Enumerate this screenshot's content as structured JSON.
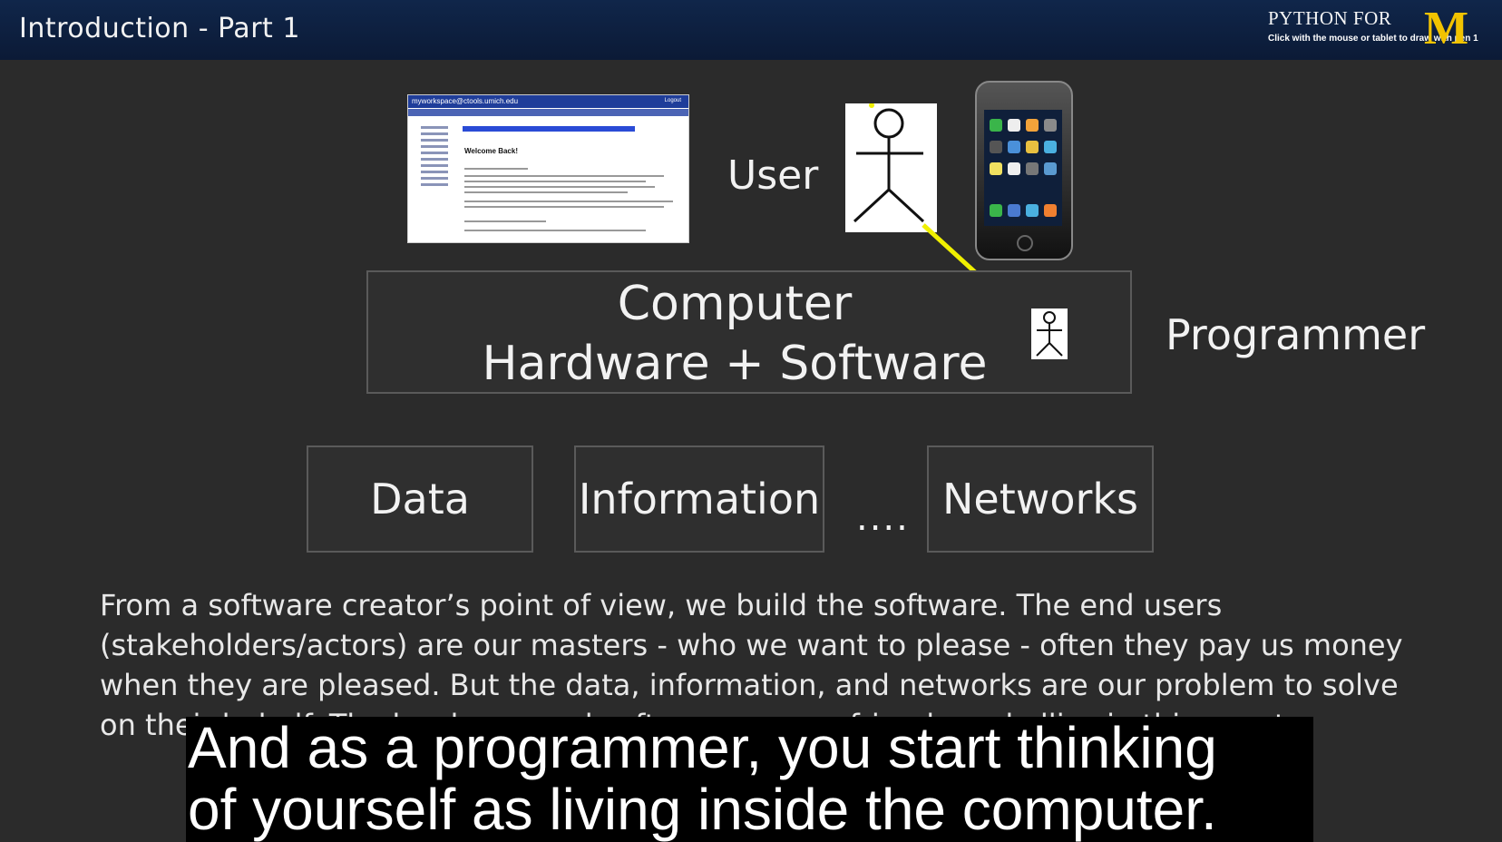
{
  "header": {
    "title": "Introduction - Part 1",
    "brand_line1": "PYTHON FOR",
    "brand_hint": "Click with the mouse or tablet to draw with pen 1",
    "logo_letter": "M"
  },
  "diagram": {
    "thumbnail": {
      "url_text": "myworkspace@ctools.umich.edu",
      "logout_text": "Logout",
      "welcome_text": "Welcome Back!"
    },
    "user_label": "User",
    "computer_line1": "Computer",
    "computer_line2": "Hardware + Software",
    "programmer_label": "Programmer",
    "boxes": [
      "Data",
      "Information",
      "Networks"
    ],
    "ellipsis": "...."
  },
  "body_text": [
    "From a software creator’s point of view, we build the software. The end users",
    "(stakeholders/actors) are our masters - who we want to please - often they pay us money",
    "when they are pleased. But the data, information, and networks are our problem to solve",
    "on their behalf. The hardware and software are our friends and allies in this quest."
  ],
  "caption": {
    "line1": "And as a programmer, you start thinking",
    "line2": "of yourself as living inside the computer."
  },
  "colors": {
    "header_bg": "#0b1a36",
    "slide_bg": "#2b2b2b",
    "arrow": "#f0f000",
    "logo": "#f2c300"
  }
}
